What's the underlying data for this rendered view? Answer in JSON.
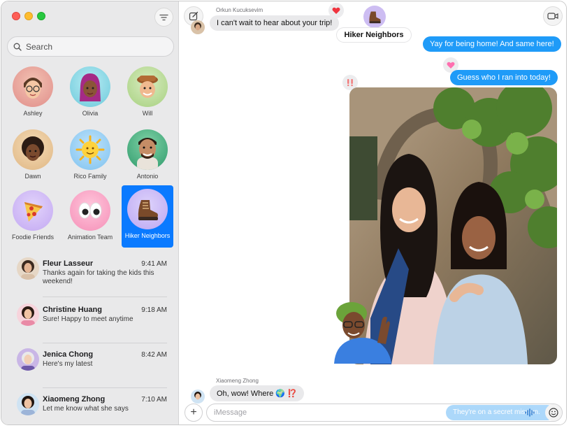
{
  "sidebar": {
    "search_placeholder": "Search",
    "pinned": [
      {
        "name": "Ashley"
      },
      {
        "name": "Olivia"
      },
      {
        "name": "Will"
      },
      {
        "name": "Dawn"
      },
      {
        "name": "Rico Family"
      },
      {
        "name": "Antonio"
      },
      {
        "name": "Foodie Friends"
      },
      {
        "name": "Animation Team"
      },
      {
        "name": "Hiker Neighbors"
      }
    ],
    "conversations": [
      {
        "name": "Fleur Lasseur",
        "time": "9:41 AM",
        "preview": "Thanks again for taking the kids this weekend!"
      },
      {
        "name": "Christine Huang",
        "time": "9:18 AM",
        "preview": "Sure! Happy to meet anytime"
      },
      {
        "name": "Jenica Chong",
        "time": "8:42 AM",
        "preview": "Here's my latest"
      },
      {
        "name": "Xiaomeng Zhong",
        "time": "7:10 AM",
        "preview": "Let me know what she says"
      }
    ]
  },
  "chat": {
    "group_name": "Hiker Neighbors",
    "messages": [
      {
        "sender": "Orkun Kucuksevim",
        "text": "I can't wait to hear about your trip!"
      },
      {
        "text": "Yay for being home! And same here!"
      },
      {
        "text": "Guess who I ran into today!"
      },
      {
        "sender": "Xiaomeng Zhong",
        "text": "Oh, wow! Where 🌍 ⁉️"
      }
    ],
    "input_placeholder": "iMessage",
    "drafting_text": "They're on a secret mission."
  },
  "colors": {
    "accent": "#0a7aff",
    "bubble_blue": "#1f9bf8",
    "bubble_gray": "#e9e9eb"
  },
  "icons": [
    "filter-icon",
    "search-icon",
    "compose-icon",
    "video-icon",
    "plus-icon",
    "emoji-icon",
    "audio-waveform-icon",
    "heart-icon",
    "exclamation-icon"
  ]
}
